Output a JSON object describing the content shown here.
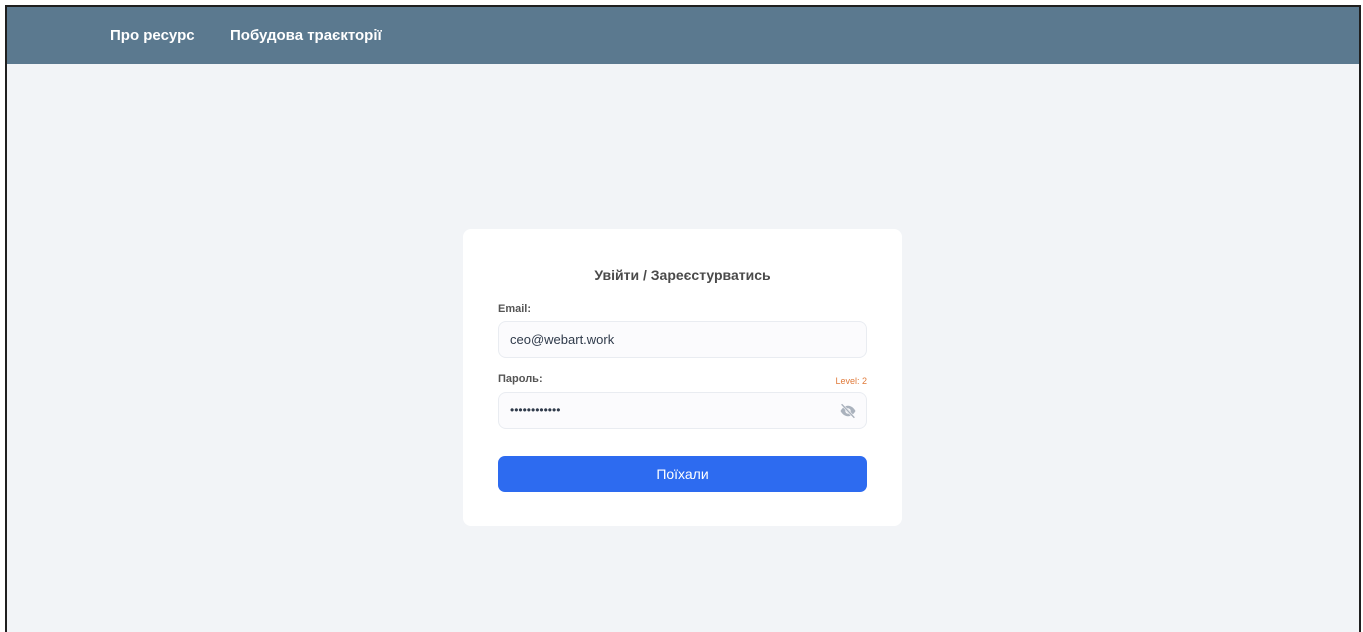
{
  "nav": {
    "items": [
      {
        "label": "Про ресурс"
      },
      {
        "label": "Побудова траєкторії"
      }
    ]
  },
  "login_card": {
    "title": "Увійти / Зареєстурватись",
    "email": {
      "label": "Email:",
      "value": "ceo@webart.work"
    },
    "password": {
      "label": "Пароль:",
      "strength": "Level: 2",
      "masked_value": "••••••••••••",
      "toggle_icon": "eye-slash-icon"
    },
    "submit_label": "Поїхали"
  },
  "colors": {
    "navbar": "#5b798f",
    "background": "#f2f4f7",
    "button": "#2d6bf0",
    "level": "#e07a3a"
  }
}
